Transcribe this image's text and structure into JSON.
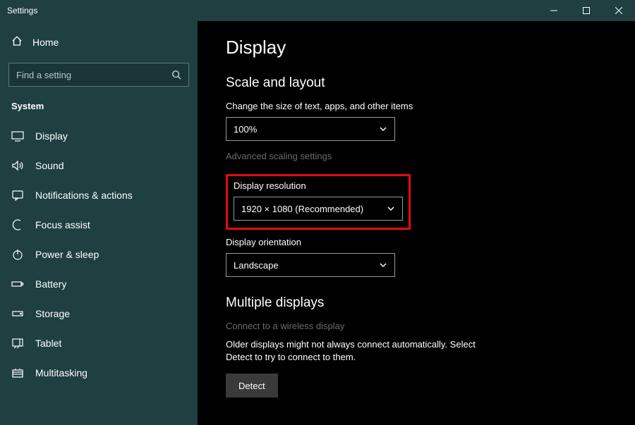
{
  "window_title": "Settings",
  "home_label": "Home",
  "search_placeholder": "Find a setting",
  "section_title": "System",
  "nav": [
    {
      "label": "Display"
    },
    {
      "label": "Sound"
    },
    {
      "label": "Notifications & actions"
    },
    {
      "label": "Focus assist"
    },
    {
      "label": "Power & sleep"
    },
    {
      "label": "Battery"
    },
    {
      "label": "Storage"
    },
    {
      "label": "Tablet"
    },
    {
      "label": "Multitasking"
    }
  ],
  "page_title": "Display",
  "scale_section": "Scale and layout",
  "scale_label": "Change the size of text, apps, and other items",
  "scale_value": "100%",
  "advanced_scaling": "Advanced scaling settings",
  "resolution_label": "Display resolution",
  "resolution_value": "1920 × 1080 (Recommended)",
  "orientation_label": "Display orientation",
  "orientation_value": "Landscape",
  "multi_section": "Multiple displays",
  "wireless_label": "Connect to a wireless display",
  "detect_text": "Older displays might not always connect automatically. Select Detect to try to connect to them.",
  "detect_button": "Detect"
}
